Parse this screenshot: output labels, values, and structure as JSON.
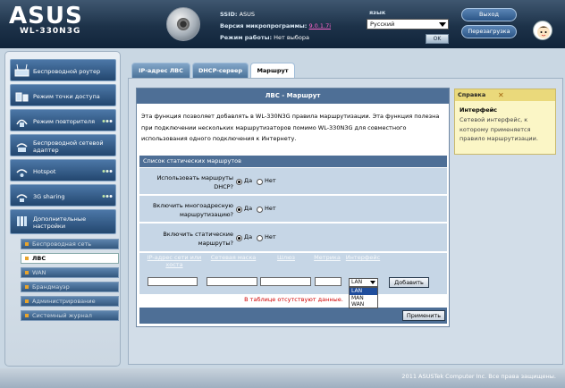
{
  "header": {
    "logo_text": "ASUS",
    "model": "WL-330N3G",
    "ssid_label": "SSID:",
    "ssid_value": "ASUS",
    "firmware_label": "Версия микропрограммы:",
    "firmware_value": "9.0.1.7i",
    "mode_label": "Режим работы:",
    "mode_value": "Нет выбора",
    "language_label": "язык",
    "language_value": "Русский",
    "ok_label": "OK",
    "logout_label": "Выход",
    "reboot_label": "Перезагрузка"
  },
  "menu": {
    "items": [
      {
        "label": "Беспроводной роутер",
        "icon": "router-icon"
      },
      {
        "label": "Режим точки доступа",
        "icon": "access-point-icon"
      },
      {
        "label": "Режим повторителя",
        "icon": "repeater-icon"
      },
      {
        "label": "Беспроводной сетевой адаптер",
        "icon": "wireless-adapter-icon"
      },
      {
        "label": "Hotspot",
        "icon": "hotspot-icon"
      },
      {
        "label": "3G sharing",
        "icon": "3g-sharing-icon"
      },
      {
        "label": "Дополнительные настройки",
        "icon": "advanced-settings-icon"
      }
    ],
    "sub_items": [
      {
        "label": "Беспроводная сеть"
      },
      {
        "label": "ЛВС"
      },
      {
        "label": "WAN"
      },
      {
        "label": "Брандмауэр"
      },
      {
        "label": "Администрирование"
      },
      {
        "label": "Системный журнал"
      }
    ]
  },
  "tabs": [
    {
      "label": "IP-адрес ЛВС"
    },
    {
      "label": "DHCP-сервер"
    },
    {
      "label": "Маршрут"
    }
  ],
  "panel": {
    "title": "ЛВС - Маршрут",
    "description": "Эта функция позволяет добавлять в WL-330N3G правила маршрутизации. Эта функция полезна при подключении нескольких маршрутизаторов помимо WL-330N3G для совместного использования одного подключения к Интернету.",
    "routes_header": "Список статических маршрутов",
    "questions": [
      {
        "label": "Использовать маршруты DHCP?",
        "yes": "Да",
        "no": "Нет",
        "value": "Да"
      },
      {
        "label": "Включить многоадресную маршрутизацию?",
        "yes": "Да",
        "no": "Нет",
        "value": "Да"
      },
      {
        "label": "Включить статические маршруты?",
        "yes": "Да",
        "no": "Нет",
        "value": "Да"
      }
    ],
    "columns": [
      "IP-адрес сети или хоста",
      "Сетевая маска",
      "Шлюз",
      "Метрика",
      "Интерфейс"
    ],
    "interface_value": "LAN",
    "interface_options": [
      "LAN",
      "MAN",
      "WAN"
    ],
    "add_label": "Добавить",
    "empty_message": "В таблице отсутствуют данные.",
    "apply_label": "Применить"
  },
  "help": {
    "title": "Справка",
    "subtitle": "Интерфейс",
    "text": "Сетевой интерфейс, к которому применяется правило маршрутизации."
  },
  "footer": {
    "copyright": "2011 ASUSTek Computer Inc. Все права защищены."
  },
  "colors": {
    "header_bg": "#1d3249",
    "menu_item_bg": "#23476f",
    "panel_title_bg": "#4e6f96",
    "row_bg": "#c6d6e6",
    "help_bg": "#fbf6c6",
    "empty_message": "#d10000"
  }
}
